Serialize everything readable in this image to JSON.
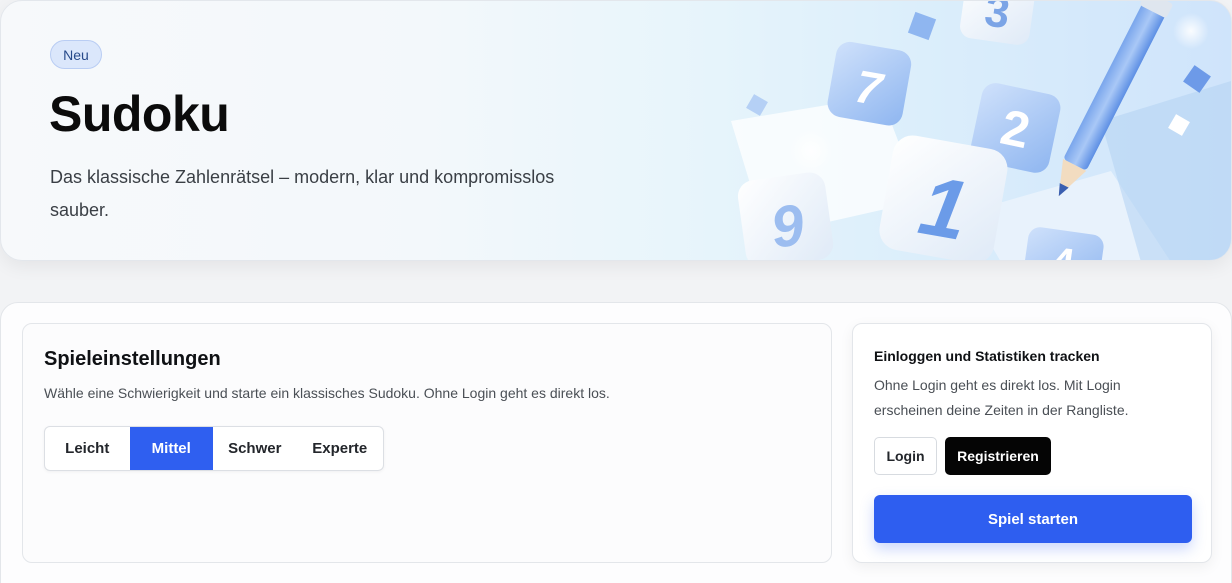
{
  "hero": {
    "badge": "Neu",
    "title": "Sudoku",
    "subtitle": "Das klassische Zahlenrätsel – modern, klar und kompromisslos sauber.",
    "illustration_digits": [
      "3",
      "7",
      "2",
      "1",
      "9",
      "4"
    ]
  },
  "settings": {
    "title": "Spieleinstellungen",
    "description": "Wähle eine Schwierigkeit und starte ein klassisches Sudoku. Ohne Login geht es direkt los.",
    "difficulties": [
      "Leicht",
      "Mittel",
      "Schwer",
      "Experte"
    ],
    "selected": "Mittel"
  },
  "account": {
    "title": "Einloggen und Statistiken tracken",
    "description": "Ohne Login geht es direkt los. Mit Login erscheinen deine Zeiten in der Rangliste.",
    "login_label": "Login",
    "register_label": "Registrieren",
    "start_label": "Spiel starten"
  },
  "colors": {
    "accent": "#2f5ff0",
    "badge_bg": "#dbe7fb",
    "dark_button": "#050505"
  }
}
